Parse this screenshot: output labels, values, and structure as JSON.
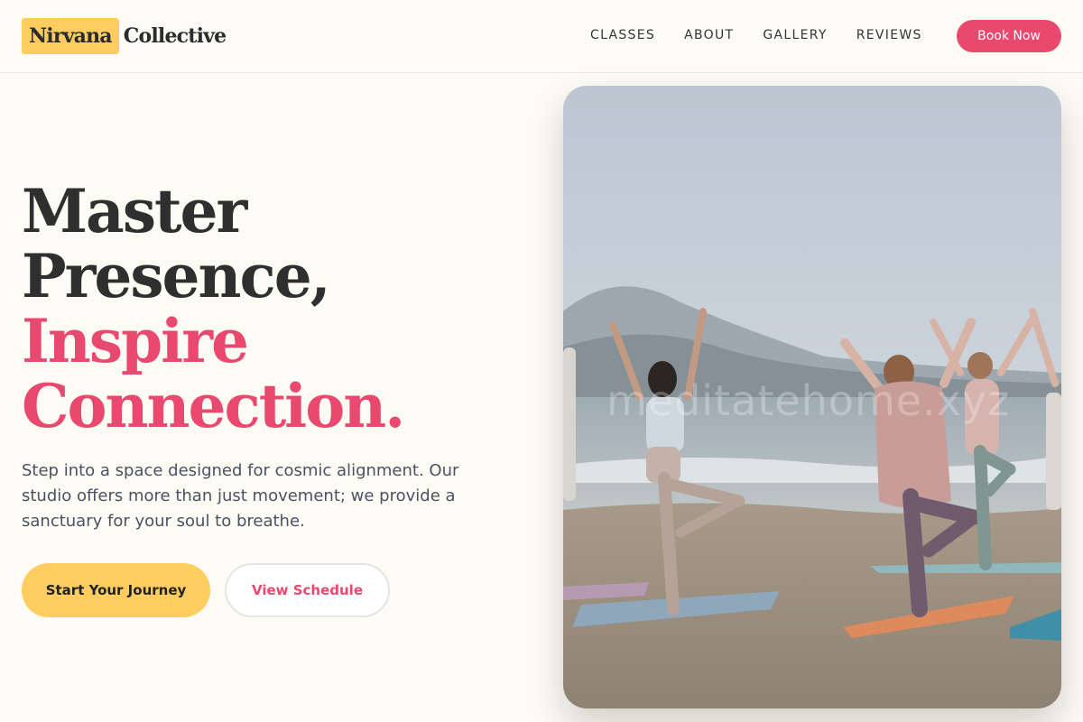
{
  "brand": {
    "mark": "Nirvana",
    "word": "Collective",
    "colors": {
      "accent": "#e9486f",
      "highlight": "#fdcd5f",
      "background": "#fdfcf4"
    }
  },
  "nav": {
    "links": [
      "CLASSES",
      "ABOUT",
      "GALLERY",
      "REVIEWS"
    ],
    "cta": "Book Now"
  },
  "hero": {
    "title_dark": [
      "Master",
      "Presence,"
    ],
    "title_accent": [
      "Inspire",
      "Connection."
    ],
    "description": "Step into a space designed for cosmic alignment. Our studio offers more than just movement; we provide a sanctuary for your soul to breathe.",
    "primary_button": "Start Your Journey",
    "secondary_button": "View Schedule"
  },
  "image": {
    "alt": "Group of people doing tree pose yoga on a beach",
    "watermark": "meditatehome.xyz"
  }
}
